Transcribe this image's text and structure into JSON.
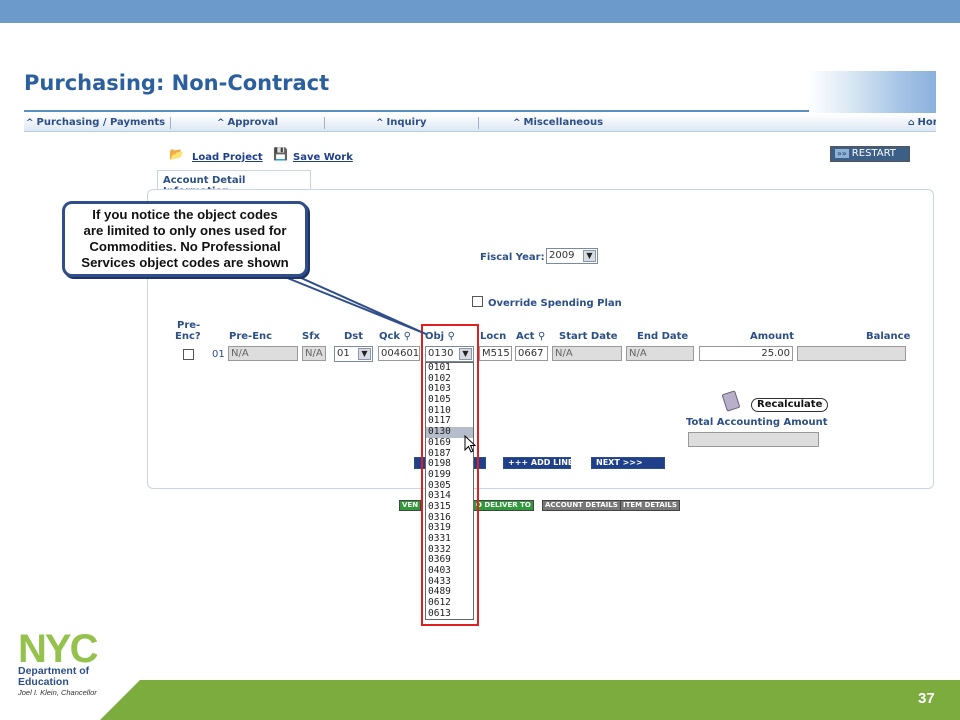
{
  "page_title": "Purchasing: Non-Contract",
  "nav": {
    "items": [
      "Purchasing / Payments",
      "Approval",
      "Inquiry",
      "Miscellaneous"
    ],
    "home_label": "Hon"
  },
  "toolbar": {
    "load_project": "Load Project",
    "save_work": "Save Work",
    "restart": "RESTART"
  },
  "tab_label": "Account Detail Information",
  "fiscal_year": {
    "label": "Fiscal Year:",
    "value": "2009"
  },
  "override_label": "Override Spending Plan",
  "columns": {
    "pre_enc": [
      "Pre-",
      "Enc?"
    ],
    "pre_enc2": "Pre-Enc",
    "sfx": "Sfx",
    "dst": "Dst",
    "qck": "Qck",
    "obj": "Obj",
    "locn": "Locn",
    "act": "Act",
    "start_date": "Start Date",
    "end_date": "End Date",
    "amount": "Amount",
    "balance": "Balance"
  },
  "row": {
    "line_no": "01",
    "pre_enc": "N/A",
    "sfx": "N/A",
    "dst": "01",
    "qck": "004601",
    "obj": "0130",
    "locn": "M515",
    "act": "0667",
    "start_date": "N/A",
    "end_date": "N/A",
    "amount": "25.00",
    "balance": ""
  },
  "object_codes": [
    "0101",
    "0102",
    "0103",
    "0105",
    "0110",
    "0117",
    "0130",
    "0169",
    "0187",
    "0198",
    "0199",
    "0305",
    "0314",
    "0315",
    "0316",
    "0319",
    "0331",
    "0332",
    "0369",
    "0403",
    "0433",
    "0489",
    "0612",
    "0613"
  ],
  "selected_object_code": "0130",
  "callout_lines": [
    "If you notice the object codes",
    "are limited to only ones used for",
    "Commodities.  No Professional",
    "Services object codes are shown"
  ],
  "recalculate_label": "Recalculate",
  "total_label": "Total Accounting Amount",
  "add_line_label": "+++ ADD LINE",
  "next_label": "NEXT  >>>",
  "steps": [
    "VEN",
    "O DELIVER TO",
    "ACCOUNT DETAILS",
    "ITEM DETAILS"
  ],
  "logo": {
    "nyc": "NYC",
    "dept": "Department of",
    "edu": "Education",
    "chancellor": "Joel I. Klein, Chancellor"
  },
  "page_number": "37",
  "colors": {
    "top_bar": "#6c9acb",
    "bottom_bar": "#7cab3e",
    "accent": "#2b5f9e",
    "highlight": "#e02020"
  }
}
